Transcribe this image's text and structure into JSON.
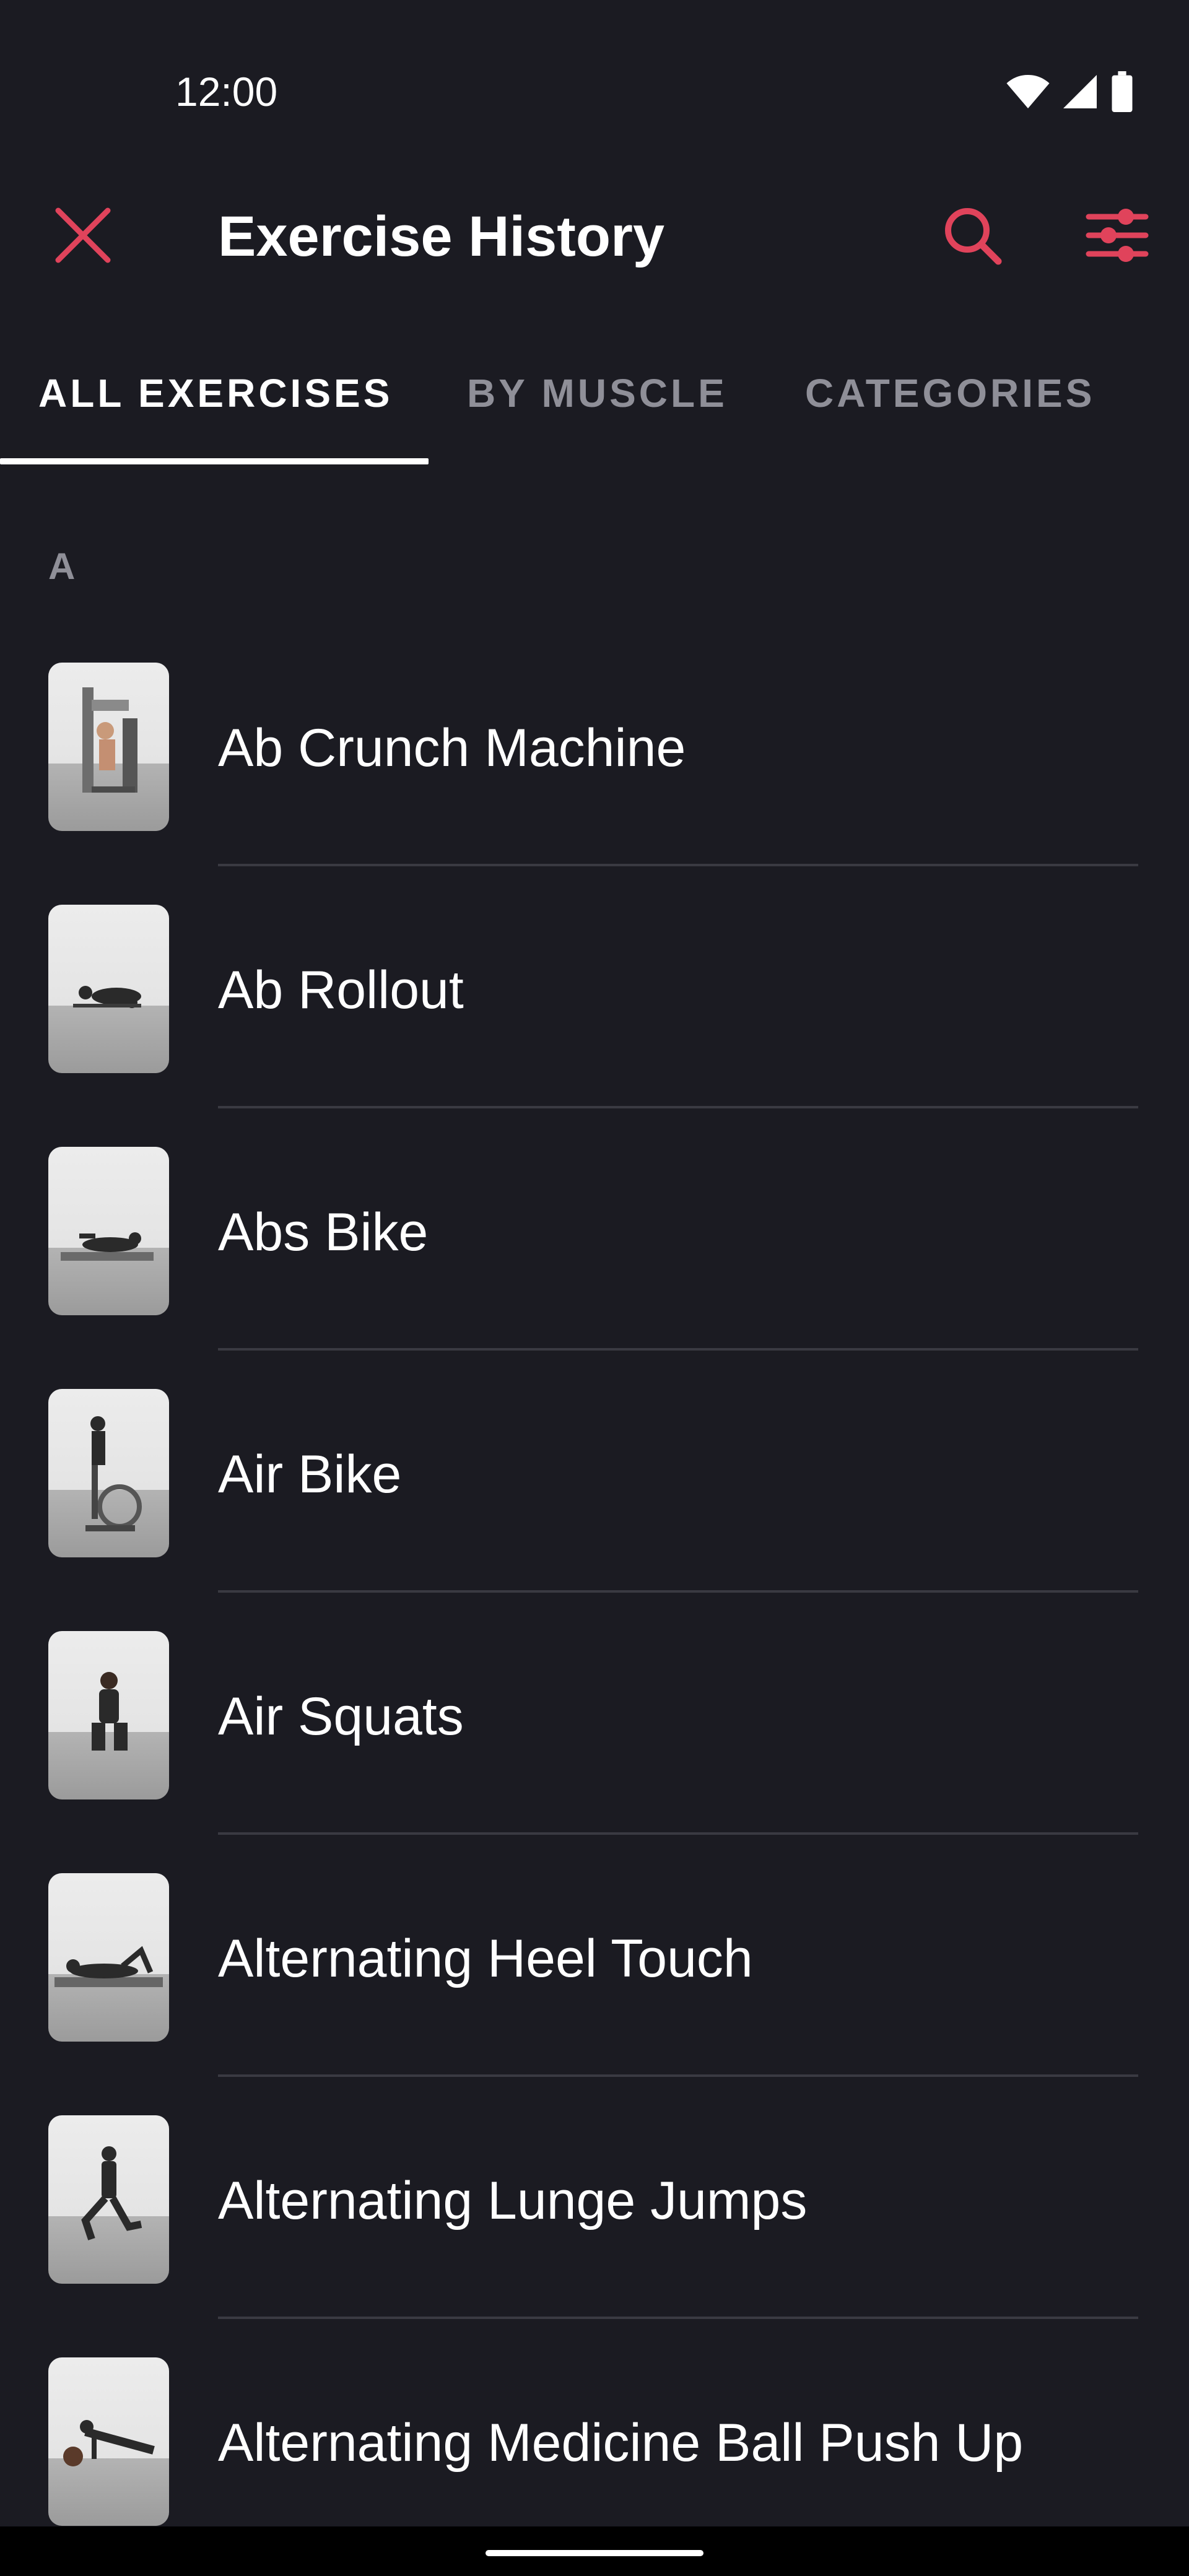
{
  "status_bar": {
    "time": "12:00",
    "icons": [
      "wifi-icon",
      "signal-icon",
      "battery-icon"
    ]
  },
  "app_bar": {
    "title": "Exercise History",
    "close_icon": "close-icon",
    "search_icon": "search-icon",
    "filter_icon": "sliders-icon"
  },
  "tabs": [
    {
      "label": "ALL EXERCISES",
      "active": true
    },
    {
      "label": "BY MUSCLE",
      "active": false
    },
    {
      "label": "CATEGORIES",
      "active": false
    }
  ],
  "section": {
    "letter": "A"
  },
  "exercises": [
    {
      "name": "Ab Crunch Machine",
      "thumbnail": "ab-crunch-machine-thumbnail"
    },
    {
      "name": "Ab Rollout",
      "thumbnail": "ab-rollout-thumbnail"
    },
    {
      "name": "Abs Bike",
      "thumbnail": "abs-bike-thumbnail"
    },
    {
      "name": "Air Bike",
      "thumbnail": "air-bike-thumbnail"
    },
    {
      "name": "Air Squats",
      "thumbnail": "air-squats-thumbnail"
    },
    {
      "name": "Alternating Heel Touch",
      "thumbnail": "alternating-heel-touch-thumbnail"
    },
    {
      "name": "Alternating Lunge Jumps",
      "thumbnail": "alternating-lunge-jumps-thumbnail"
    },
    {
      "name": "Alternating Medicine Ball Push Up",
      "thumbnail": "alternating-medicine-ball-push-up-thumbnail"
    }
  ],
  "colors": {
    "background": "#1b1b22",
    "accent": "#e0435b",
    "text_primary": "#ffffff",
    "text_secondary": "#8f8f98",
    "divider": "#3a3a42"
  }
}
